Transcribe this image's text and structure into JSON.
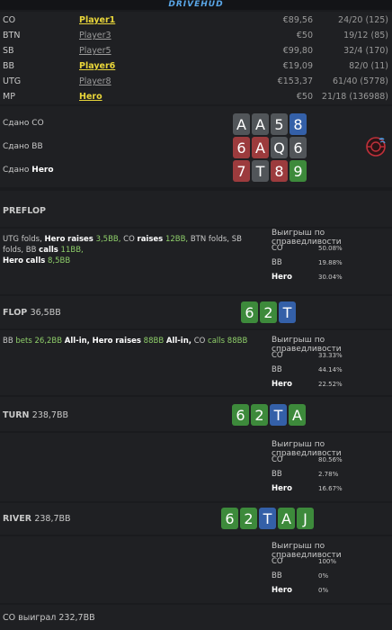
{
  "brand": "DRIVEHUD",
  "players": [
    {
      "pos": "CO",
      "name": "Player1",
      "bank": "€89,56",
      "stat": "24/20 (125)"
    },
    {
      "pos": "BTN",
      "name": "Player3",
      "bank": "€50",
      "stat": "19/12 (85)"
    },
    {
      "pos": "SB",
      "name": "Player5",
      "bank": "€99,80",
      "stat": "32/4 (170)"
    },
    {
      "pos": "BB",
      "name": "Player6",
      "bank": "€19,09",
      "stat": "82/0 (11)"
    },
    {
      "pos": "UTG",
      "name": "Player8",
      "bank": "€153,37",
      "stat": "61/40 (5778)"
    },
    {
      "pos": "MP",
      "name": "Hero",
      "bank": "€50",
      "stat": "21/18 (136988)"
    }
  ],
  "dealt": [
    {
      "label": "Сдано",
      "player": "CO",
      "cards": [
        "A",
        "A",
        "5",
        "8"
      ]
    },
    {
      "label": "Сдано",
      "player": "BB",
      "cards": [
        "6",
        "A",
        "Q",
        "6"
      ]
    },
    {
      "label": "Сдано",
      "player": "Hero",
      "cards": [
        "7",
        "T",
        "8",
        "9"
      ]
    }
  ],
  "preflop": {
    "title": "PREFLOP",
    "action": {
      "a1": "UTG folds,",
      "a2": "Hero",
      "a3": "raises",
      "a4": "3,5BB,",
      "a5": "CO",
      "a6": "raises",
      "a7": "12BB,",
      "a8": "BTN folds,",
      "a9": "SB folds,",
      "a10": "BB",
      "a11": "calls",
      "a12": "11BB,",
      "a13": "Hero",
      "a14": "calls",
      "a15": "8,5BB"
    }
  },
  "flop": {
    "title": "FLOP",
    "pot": "36,5BB",
    "cards": [
      "6",
      "2",
      "T"
    ],
    "action": {
      "a1": "BB",
      "a2": "bets",
      "a3": "26,2BB",
      "a4": "All-in,",
      "a5": "Hero",
      "a6": "raises",
      "a7": "88BB",
      "a8": "All-in,",
      "a9": "CO",
      "a10": "calls",
      "a11": "88BB"
    }
  },
  "turn": {
    "title": "TURN",
    "pot": "238,7BB",
    "cards": [
      "6",
      "2",
      "T",
      "A"
    ]
  },
  "river": {
    "title": "RIVER",
    "pot": "238,7BB",
    "cards": [
      "6",
      "2",
      "T",
      "A",
      "J"
    ]
  },
  "equity_header": "Выигрыш по справедливости",
  "equity": {
    "preflop": [
      {
        "name": "CO",
        "value": "50.08%"
      },
      {
        "name": "BB",
        "value": "19.88%"
      },
      {
        "name": "Hero",
        "value": "30.04%"
      }
    ],
    "flop": [
      {
        "name": "CO",
        "value": "33.33%"
      },
      {
        "name": "BB",
        "value": "44.14%"
      },
      {
        "name": "Hero",
        "value": "22.52%"
      }
    ],
    "turn": [
      {
        "name": "CO",
        "value": "80.56%"
      },
      {
        "name": "BB",
        "value": "2.78%"
      },
      {
        "name": "Hero",
        "value": "16.67%"
      }
    ],
    "river": [
      {
        "name": "CO",
        "value": "100%"
      },
      {
        "name": "BB",
        "value": "0%"
      },
      {
        "name": "Hero",
        "value": "0%"
      }
    ]
  },
  "result": {
    "player": "CO",
    "text": "выиграл",
    "amount": "232,7BB"
  },
  "colors": {
    "spade": "#515559",
    "diamond": "#3460a8",
    "heart": "#9c3b3d",
    "club": "#3d8a3b",
    "highlight": "#e9d63a",
    "action_green": "#8fcf6a"
  }
}
